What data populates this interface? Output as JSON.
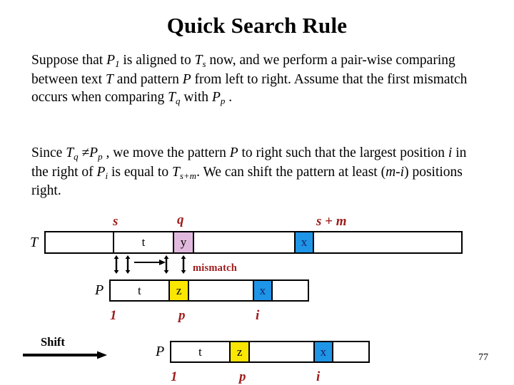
{
  "slide": {
    "title": "Quick Search Rule",
    "page_number": "77"
  },
  "paragraphs": {
    "p1": {
      "seg_1": "Suppose that ",
      "var_P": "P",
      "sub_1": "1",
      "seg_2": " is aligned to ",
      "var_T": "T",
      "sub_s": "s",
      "seg_3": " now, and we perform a pair-wise comparing between text ",
      "var_T2": "T",
      "seg_4": " and pattern ",
      "var_P2": "P",
      "seg_5": " from left to right. Assume that the first mismatch occurs when comparing ",
      "var_T3": "T",
      "sub_q": "q",
      "seg_6": " with ",
      "var_P3": "P",
      "sub_p": "p",
      "seg_7": " ."
    },
    "p2": {
      "seg_1": "Since ",
      "var_T": "T",
      "sub_q": "q",
      "neq": " ≠",
      "var_P": "P",
      "sub_p": "p",
      "seg_2": " , we move the pattern ",
      "var_P2": "P",
      "seg_3": " to right such that the largest position ",
      "var_i": "i",
      "seg_4": " in the right of ",
      "var_P3": "P",
      "sub_i": "i",
      "seg_5": " is equal to ",
      "var_T2": "T",
      "sub_sm": "s+m",
      "seg_6": ". We can shift the pattern at least (",
      "var_m": "m-i",
      "seg_7": ") positions right."
    }
  },
  "diagram": {
    "text_row": {
      "label": "T",
      "cells": [
        {
          "text": "",
          "fill": "none"
        },
        {
          "text": "t",
          "fill": "none"
        },
        {
          "text": "y",
          "fill": "pink"
        },
        {
          "text": "",
          "fill": "none"
        },
        {
          "text": "x",
          "fill": "blue"
        },
        {
          "text": "",
          "fill": "none"
        }
      ],
      "labels": {
        "s": "s",
        "q": "q",
        "s_plus_m": "s + m"
      }
    },
    "mismatch_note": "mismatch",
    "pattern_row_1": {
      "label": "P",
      "cells": [
        {
          "text": "t",
          "fill": "none"
        },
        {
          "text": "z",
          "fill": "yellow"
        },
        {
          "text": "",
          "fill": "none"
        },
        {
          "text": "x",
          "fill": "blue"
        },
        {
          "text": "",
          "fill": "none"
        }
      ],
      "labels": {
        "start": "1",
        "p": "p",
        "i": "i"
      }
    },
    "pattern_row_2": {
      "label": "P",
      "cells": [
        {
          "text": "t",
          "fill": "none"
        },
        {
          "text": "z",
          "fill": "yellow"
        },
        {
          "text": "",
          "fill": "none"
        },
        {
          "text": "x",
          "fill": "blue"
        },
        {
          "text": "",
          "fill": "none"
        }
      ],
      "labels": {
        "start": "1",
        "p": "p",
        "i": "i"
      }
    },
    "shift": {
      "label": "Shift"
    }
  },
  "colors": {
    "highlight_pink": "#e2b9de",
    "highlight_blue": "#1e95e6",
    "highlight_yellow": "#fae600",
    "annotation_red": "#9e1b1b",
    "outline": "#000000"
  }
}
